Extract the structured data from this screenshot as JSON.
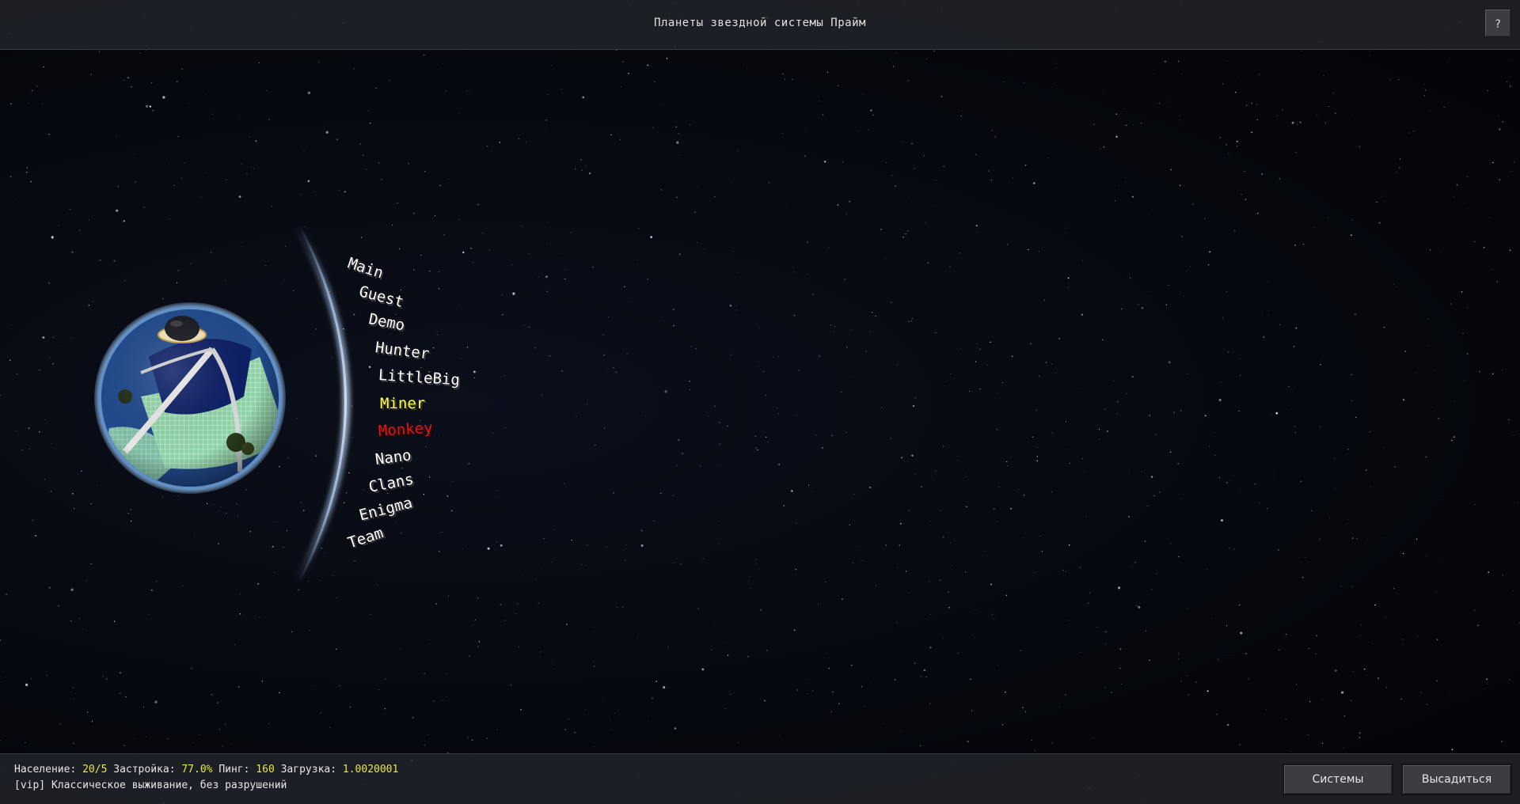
{
  "header": {
    "title": "Планеты звездной системы Прайм",
    "help_label": "?"
  },
  "planet_menu": {
    "items": [
      {
        "label": "Main",
        "color": "#ffffff"
      },
      {
        "label": "Guest",
        "color": "#ffffff"
      },
      {
        "label": "Demo",
        "color": "#ffffff"
      },
      {
        "label": "Hunter",
        "color": "#ffffff"
      },
      {
        "label": "LittleBig",
        "color": "#ffffff"
      },
      {
        "label": "Miner",
        "color": "#ffff55"
      },
      {
        "label": "Monkey",
        "color": "#e01818"
      },
      {
        "label": "Nano",
        "color": "#ffffff"
      },
      {
        "label": "Clans",
        "color": "#ffffff"
      },
      {
        "label": "Enigma",
        "color": "#ffffff"
      },
      {
        "label": "Team",
        "color": "#ffffff"
      }
    ],
    "selected": "Monkey",
    "hovered": "Miner"
  },
  "status": {
    "population_label": "Население:",
    "population_value": "20/5",
    "build_label": "Застройка:",
    "build_value": "77.0%",
    "ping_label": "Пинг:",
    "ping_value": "160",
    "load_label": "Загрузка:",
    "load_value": "1.0020001",
    "description": "[vip] Классическое выживание, без разрушений"
  },
  "buttons": {
    "systems_label": "Системы",
    "land_label": "Высадиться"
  },
  "colors": {
    "highlight_value": "#e8e83a",
    "arc_glow": "#a8c8ee",
    "planet_water": "#1f3f8c",
    "planet_grass": "#8fd4a8"
  }
}
